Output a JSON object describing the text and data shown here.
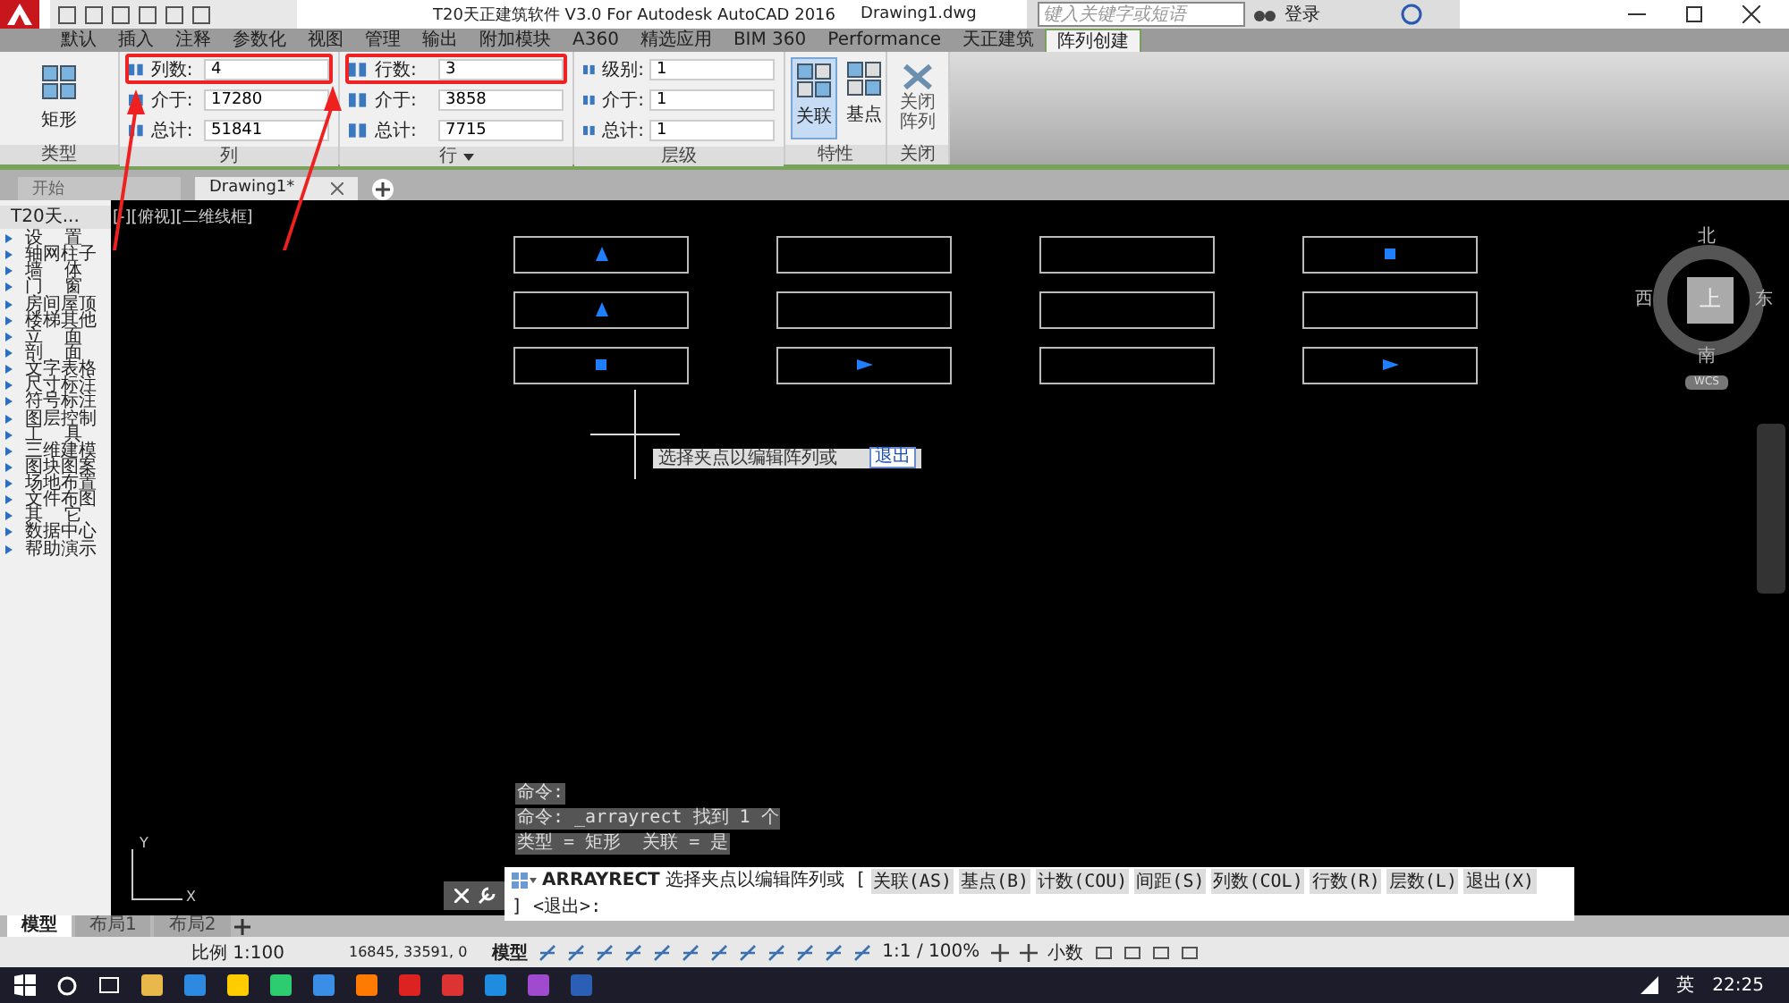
{
  "title_bar": {
    "app_title": "T20天正建筑软件 V3.0 For Autodesk AutoCAD 2016",
    "file_name": "Drawing1.dwg",
    "search": {
      "placeholder": "键入关键字或短语"
    },
    "login": "登录"
  },
  "ribbon_tabs": [
    {
      "label": "默认",
      "selected": false
    },
    {
      "label": "插入",
      "selected": false
    },
    {
      "label": "注释",
      "selected": false
    },
    {
      "label": "参数化",
      "selected": false
    },
    {
      "label": "视图",
      "selected": false
    },
    {
      "label": "管理",
      "selected": false
    },
    {
      "label": "输出",
      "selected": false
    },
    {
      "label": "附加模块",
      "selected": false
    },
    {
      "label": "A360",
      "selected": false
    },
    {
      "label": "精选应用",
      "selected": false
    },
    {
      "label": "BIM 360",
      "selected": false
    },
    {
      "label": "Performance",
      "selected": false
    },
    {
      "label": "天正建筑",
      "selected": false
    },
    {
      "label": "阵列创建",
      "selected": true
    }
  ],
  "ribbon": {
    "type_panel": {
      "button": "矩形",
      "title": "类型"
    },
    "field_panels": [
      {
        "title": "列",
        "fields": [
          {
            "label": "列数:",
            "value": "4",
            "marked": true
          },
          {
            "label": "介于:",
            "value": "17280",
            "marked": false
          },
          {
            "label": "总计:",
            "value": "51841",
            "marked": false
          }
        ]
      },
      {
        "title": "行",
        "caret": true,
        "fields": [
          {
            "label": "行数:",
            "value": "3",
            "marked": true
          },
          {
            "label": "介于:",
            "value": "3858",
            "marked": false
          },
          {
            "label": "总计:",
            "value": "7715",
            "marked": false
          }
        ]
      },
      {
        "title": "层级",
        "fields": [
          {
            "label": "级别:",
            "value": "1",
            "marked": false
          },
          {
            "label": "介于:",
            "value": "1",
            "marked": false
          },
          {
            "label": "总计:",
            "value": "1",
            "marked": false
          }
        ]
      }
    ],
    "properties_panel": {
      "title": "特性",
      "buttons": [
        {
          "label": "关联",
          "selected": true
        },
        {
          "label": "基点",
          "selected": false
        }
      ]
    },
    "close_panel": {
      "title": "关闭",
      "button": "关闭阵列"
    }
  },
  "doc_tabs": [
    {
      "label": "开始",
      "selected": false
    },
    {
      "label": "Drawing1*",
      "selected": true,
      "closable": true
    }
  ],
  "sidebar": {
    "title": "T20天...",
    "items": [
      "设置",
      "轴网柱子",
      "墙体",
      "门窗",
      "房间屋顶",
      "楼梯其他",
      "立面",
      "剖面",
      "文字表格",
      "尺寸标注",
      "符号标注",
      "图层控制",
      "工具",
      "三维建模",
      "图块图案",
      "场地布置",
      "文件布图",
      "其它",
      "数据中心",
      "帮助演示"
    ]
  },
  "canvas": {
    "viewport_label": "[-][俯视][二维线框]",
    "array_cells": [
      {
        "kind": "uparrow"
      },
      {
        "kind": "plain"
      },
      {
        "kind": "plain"
      },
      {
        "kind": "square"
      },
      {
        "kind": "uparrow"
      },
      {
        "kind": "plain"
      },
      {
        "kind": "plain"
      },
      {
        "kind": "plain"
      },
      {
        "kind": "square"
      },
      {
        "kind": "rightarrow"
      },
      {
        "kind": "plain"
      },
      {
        "kind": "rightarrow"
      }
    ],
    "tooltip": {
      "prompt": "选择夹点以编辑阵列或",
      "value": "退出"
    },
    "viewcube": {
      "north": "北",
      "south": "南",
      "east": "东",
      "west": "西",
      "face": "上",
      "wcs": "WCS"
    },
    "ucs": {
      "x": "X",
      "y": "Y"
    },
    "history": [
      "命令:",
      "命令: _arrayrect 找到 1 个",
      "类型 = 矩形  关联 = 是"
    ],
    "command_line": {
      "command": "ARRAYRECT",
      "prompt": "选择夹点以编辑阵列或 [",
      "options": [
        "关联(AS)",
        "基点(B)",
        "计数(COU)",
        "间距(S)",
        "列数(COL)",
        "行数(R)",
        "层数(L)",
        "退出(X)"
      ],
      "tail": "] <退出>:"
    }
  },
  "layout_tabs": [
    {
      "label": "模型",
      "selected": true
    },
    {
      "label": "布局1",
      "selected": false
    },
    {
      "label": "布局2",
      "selected": false
    }
  ],
  "status_bar": {
    "scale": "比例 1:100",
    "coordinates": "16845, 33591, 0",
    "space": "模型",
    "annotation_scale": "1:1 / 100%",
    "units": "小数"
  },
  "taskbar": {
    "language": "英",
    "time": "22:25"
  }
}
